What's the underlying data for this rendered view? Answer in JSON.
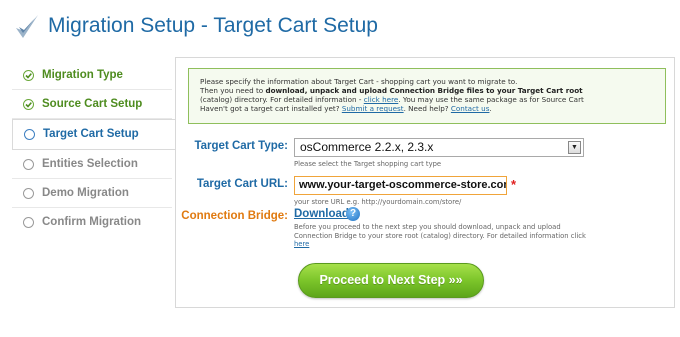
{
  "header": {
    "title": "Migration Setup - Target Cart Setup",
    "logo_icon": "checkmark-swoosh-icon"
  },
  "sidebar": {
    "items": [
      {
        "label": "Migration Type",
        "state": "done"
      },
      {
        "label": "Source Cart Setup",
        "state": "done"
      },
      {
        "label": "Target Cart Setup",
        "state": "active"
      },
      {
        "label": "Entities Selection",
        "state": "pending"
      },
      {
        "label": "Demo Migration",
        "state": "pending"
      },
      {
        "label": "Confirm Migration",
        "state": "pending"
      }
    ]
  },
  "notice": {
    "line1": "Please specify the information about Target Cart - shopping cart you want to migrate to.",
    "line2_pre": "Then you need to ",
    "line2_bold": "download, unpack and upload Connection Bridge files to your Target Cart root",
    "line3_pre": "(catalog) directory. For detailed information - ",
    "line3_link": "click here",
    "line3_post": ". You may use the same package as for Source Cart",
    "line4_pre": "Haven't got a target cart installed yet? ",
    "line4_link1": "Submit a request",
    "line4_mid": ". Need help? ",
    "line4_link2": "Contact us",
    "line4_post": "."
  },
  "form": {
    "cart_type_label": "Target Cart Type:",
    "cart_type_value": "osCommerce 2.2.x, 2.3.x",
    "cart_type_hint": "Please select the Target shopping cart type",
    "cart_url_label": "Target Cart URL:",
    "cart_url_value": "www.your-target-oscommerce-store.com",
    "cart_url_required": "*",
    "cart_url_hint": "your store URL e.g. http://yourdomain.com/store/",
    "bridge_label": "Connection Bridge:",
    "download_label": "Download",
    "help_glyph": "?",
    "bridge_desc_1": "Before you proceed to the next step you should download, unpack and upload",
    "bridge_desc_2": "Connection Bridge to your store root (catalog) directory. For detailed information click",
    "bridge_desc_link": "here"
  },
  "actions": {
    "proceed_label": "Proceed to Next Step »»"
  },
  "colors": {
    "title_blue": "#1f6aa5",
    "done_green": "#4e8c1f",
    "bridge_orange": "#e07a10",
    "button_green": "#7cc52a"
  }
}
